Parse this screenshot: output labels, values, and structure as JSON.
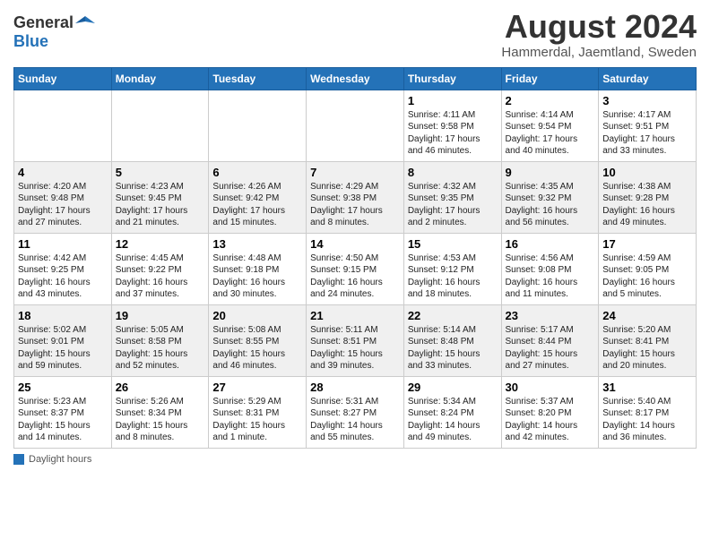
{
  "header": {
    "logo_general": "General",
    "logo_blue": "Blue",
    "title": "August 2024",
    "subtitle": "Hammerdal, Jaemtland, Sweden"
  },
  "days_of_week": [
    "Sunday",
    "Monday",
    "Tuesday",
    "Wednesday",
    "Thursday",
    "Friday",
    "Saturday"
  ],
  "weeks": [
    {
      "days": [
        {
          "num": "",
          "info": ""
        },
        {
          "num": "",
          "info": ""
        },
        {
          "num": "",
          "info": ""
        },
        {
          "num": "",
          "info": ""
        },
        {
          "num": "1",
          "info": "Sunrise: 4:11 AM\nSunset: 9:58 PM\nDaylight: 17 hours and 46 minutes."
        },
        {
          "num": "2",
          "info": "Sunrise: 4:14 AM\nSunset: 9:54 PM\nDaylight: 17 hours and 40 minutes."
        },
        {
          "num": "3",
          "info": "Sunrise: 4:17 AM\nSunset: 9:51 PM\nDaylight: 17 hours and 33 minutes."
        }
      ]
    },
    {
      "days": [
        {
          "num": "4",
          "info": "Sunrise: 4:20 AM\nSunset: 9:48 PM\nDaylight: 17 hours and 27 minutes."
        },
        {
          "num": "5",
          "info": "Sunrise: 4:23 AM\nSunset: 9:45 PM\nDaylight: 17 hours and 21 minutes."
        },
        {
          "num": "6",
          "info": "Sunrise: 4:26 AM\nSunset: 9:42 PM\nDaylight: 17 hours and 15 minutes."
        },
        {
          "num": "7",
          "info": "Sunrise: 4:29 AM\nSunset: 9:38 PM\nDaylight: 17 hours and 8 minutes."
        },
        {
          "num": "8",
          "info": "Sunrise: 4:32 AM\nSunset: 9:35 PM\nDaylight: 17 hours and 2 minutes."
        },
        {
          "num": "9",
          "info": "Sunrise: 4:35 AM\nSunset: 9:32 PM\nDaylight: 16 hours and 56 minutes."
        },
        {
          "num": "10",
          "info": "Sunrise: 4:38 AM\nSunset: 9:28 PM\nDaylight: 16 hours and 49 minutes."
        }
      ]
    },
    {
      "days": [
        {
          "num": "11",
          "info": "Sunrise: 4:42 AM\nSunset: 9:25 PM\nDaylight: 16 hours and 43 minutes."
        },
        {
          "num": "12",
          "info": "Sunrise: 4:45 AM\nSunset: 9:22 PM\nDaylight: 16 hours and 37 minutes."
        },
        {
          "num": "13",
          "info": "Sunrise: 4:48 AM\nSunset: 9:18 PM\nDaylight: 16 hours and 30 minutes."
        },
        {
          "num": "14",
          "info": "Sunrise: 4:50 AM\nSunset: 9:15 PM\nDaylight: 16 hours and 24 minutes."
        },
        {
          "num": "15",
          "info": "Sunrise: 4:53 AM\nSunset: 9:12 PM\nDaylight: 16 hours and 18 minutes."
        },
        {
          "num": "16",
          "info": "Sunrise: 4:56 AM\nSunset: 9:08 PM\nDaylight: 16 hours and 11 minutes."
        },
        {
          "num": "17",
          "info": "Sunrise: 4:59 AM\nSunset: 9:05 PM\nDaylight: 16 hours and 5 minutes."
        }
      ]
    },
    {
      "days": [
        {
          "num": "18",
          "info": "Sunrise: 5:02 AM\nSunset: 9:01 PM\nDaylight: 15 hours and 59 minutes."
        },
        {
          "num": "19",
          "info": "Sunrise: 5:05 AM\nSunset: 8:58 PM\nDaylight: 15 hours and 52 minutes."
        },
        {
          "num": "20",
          "info": "Sunrise: 5:08 AM\nSunset: 8:55 PM\nDaylight: 15 hours and 46 minutes."
        },
        {
          "num": "21",
          "info": "Sunrise: 5:11 AM\nSunset: 8:51 PM\nDaylight: 15 hours and 39 minutes."
        },
        {
          "num": "22",
          "info": "Sunrise: 5:14 AM\nSunset: 8:48 PM\nDaylight: 15 hours and 33 minutes."
        },
        {
          "num": "23",
          "info": "Sunrise: 5:17 AM\nSunset: 8:44 PM\nDaylight: 15 hours and 27 minutes."
        },
        {
          "num": "24",
          "info": "Sunrise: 5:20 AM\nSunset: 8:41 PM\nDaylight: 15 hours and 20 minutes."
        }
      ]
    },
    {
      "days": [
        {
          "num": "25",
          "info": "Sunrise: 5:23 AM\nSunset: 8:37 PM\nDaylight: 15 hours and 14 minutes."
        },
        {
          "num": "26",
          "info": "Sunrise: 5:26 AM\nSunset: 8:34 PM\nDaylight: 15 hours and 8 minutes."
        },
        {
          "num": "27",
          "info": "Sunrise: 5:29 AM\nSunset: 8:31 PM\nDaylight: 15 hours and 1 minute."
        },
        {
          "num": "28",
          "info": "Sunrise: 5:31 AM\nSunset: 8:27 PM\nDaylight: 14 hours and 55 minutes."
        },
        {
          "num": "29",
          "info": "Sunrise: 5:34 AM\nSunset: 8:24 PM\nDaylight: 14 hours and 49 minutes."
        },
        {
          "num": "30",
          "info": "Sunrise: 5:37 AM\nSunset: 8:20 PM\nDaylight: 14 hours and 42 minutes."
        },
        {
          "num": "31",
          "info": "Sunrise: 5:40 AM\nSunset: 8:17 PM\nDaylight: 14 hours and 36 minutes."
        }
      ]
    }
  ],
  "footer": {
    "label": "Daylight hours"
  }
}
